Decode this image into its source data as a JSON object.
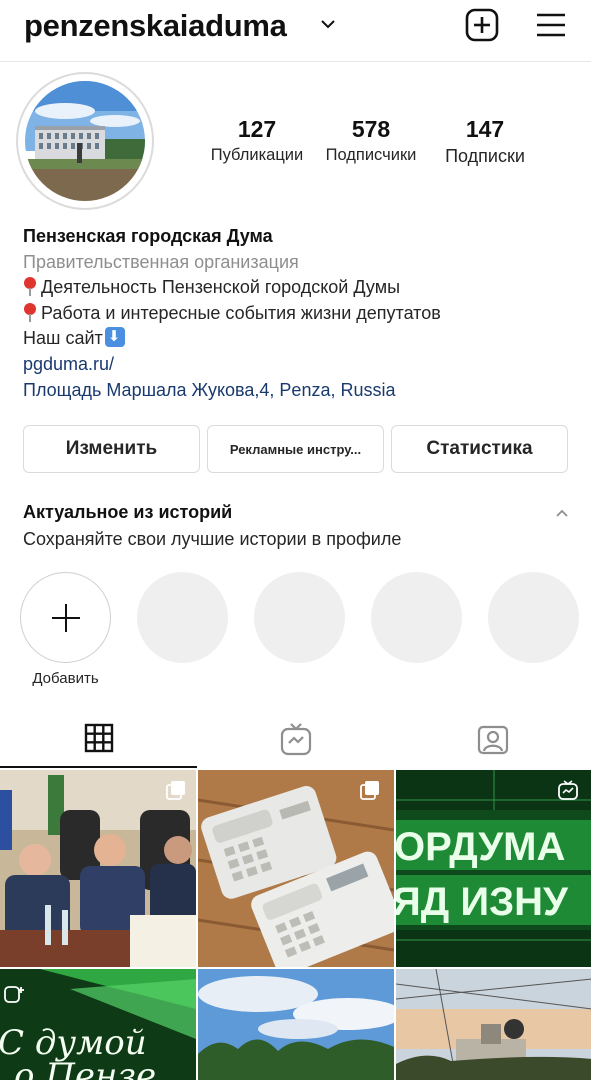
{
  "header": {
    "username": "penzenskaiaduma",
    "chevron_icon": "chevron-down-icon",
    "new_post_icon": "plus-square-icon",
    "menu_icon": "hamburger-menu-icon"
  },
  "profile": {
    "avatar_icon": "profile-photo",
    "stats": [
      {
        "value": "127",
        "label": "Публикации"
      },
      {
        "value": "578",
        "label": "Подписчики"
      },
      {
        "value": "147",
        "label": "Подписки"
      }
    ],
    "name": "Пензенская городская Дума",
    "category": "Правительственная организация",
    "bio_line_1": "Деятельность Пензенской городской Думы",
    "bio_line_2": "Работа и интересные события жизни депутатов",
    "bio_line_3": "Наш сайт",
    "website": "pgduma.ru/",
    "address": "Площадь Маршала Жукова,4, Penza, Russia"
  },
  "buttons": {
    "edit": "Изменить",
    "ads": "Рекламные инстру...",
    "stats": "Статистика"
  },
  "highlights": {
    "title": "Актуальное из историй",
    "subtitle": "Сохраняйте свои лучшие истории в профиле",
    "add_label": "Добавить",
    "collapse_icon": "chevron-up-icon"
  },
  "tabs": [
    {
      "icon": "grid-icon",
      "active": true
    },
    {
      "icon": "igtv-icon",
      "active": false
    },
    {
      "icon": "tagged-icon",
      "active": false
    }
  ],
  "posts": {
    "post_3_text_line_1": "ОРДУМА",
    "post_3_text_line_2": "ЯД ИЗНУ",
    "post_4_text_line_1": "С думой",
    "post_4_text_line_2": "о Пензе"
  }
}
